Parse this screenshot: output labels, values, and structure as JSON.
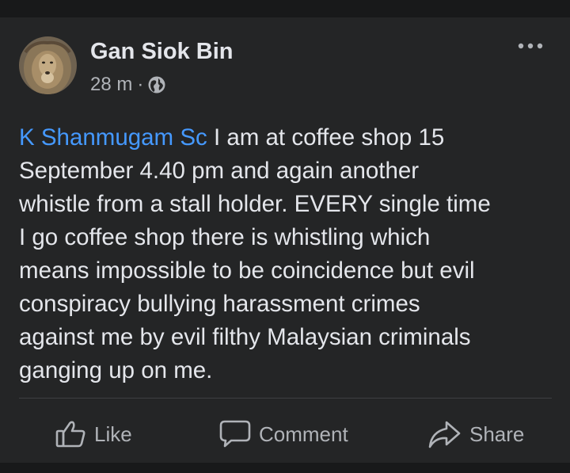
{
  "post": {
    "author": "Gan Siok Bin",
    "timestamp": "28 m",
    "separator": "·",
    "privacy_icon": "globe-icon",
    "more_icon": "more-options-icon",
    "mention": "K Shanmugam Sc",
    "body": " I am at coffee shop  15\nSeptember 4.40 pm and again another\nwhistle from a stall holder.  EVERY single time\nI go coffee shop there is whistling which\nmeans impossible to be coincidence but evil\nconspiracy bullying harassment crimes\nagainst me by evil filthy Malaysian criminals\nganging up on me."
  },
  "actions": {
    "like_label": "Like",
    "comment_label": "Comment",
    "share_label": "Share"
  },
  "colors": {
    "background": "#18191a",
    "card": "#242526",
    "primary_text": "#e4e6eb",
    "secondary_text": "#b0b3b8",
    "mention": "#4599ff",
    "divider": "#3e4042"
  }
}
